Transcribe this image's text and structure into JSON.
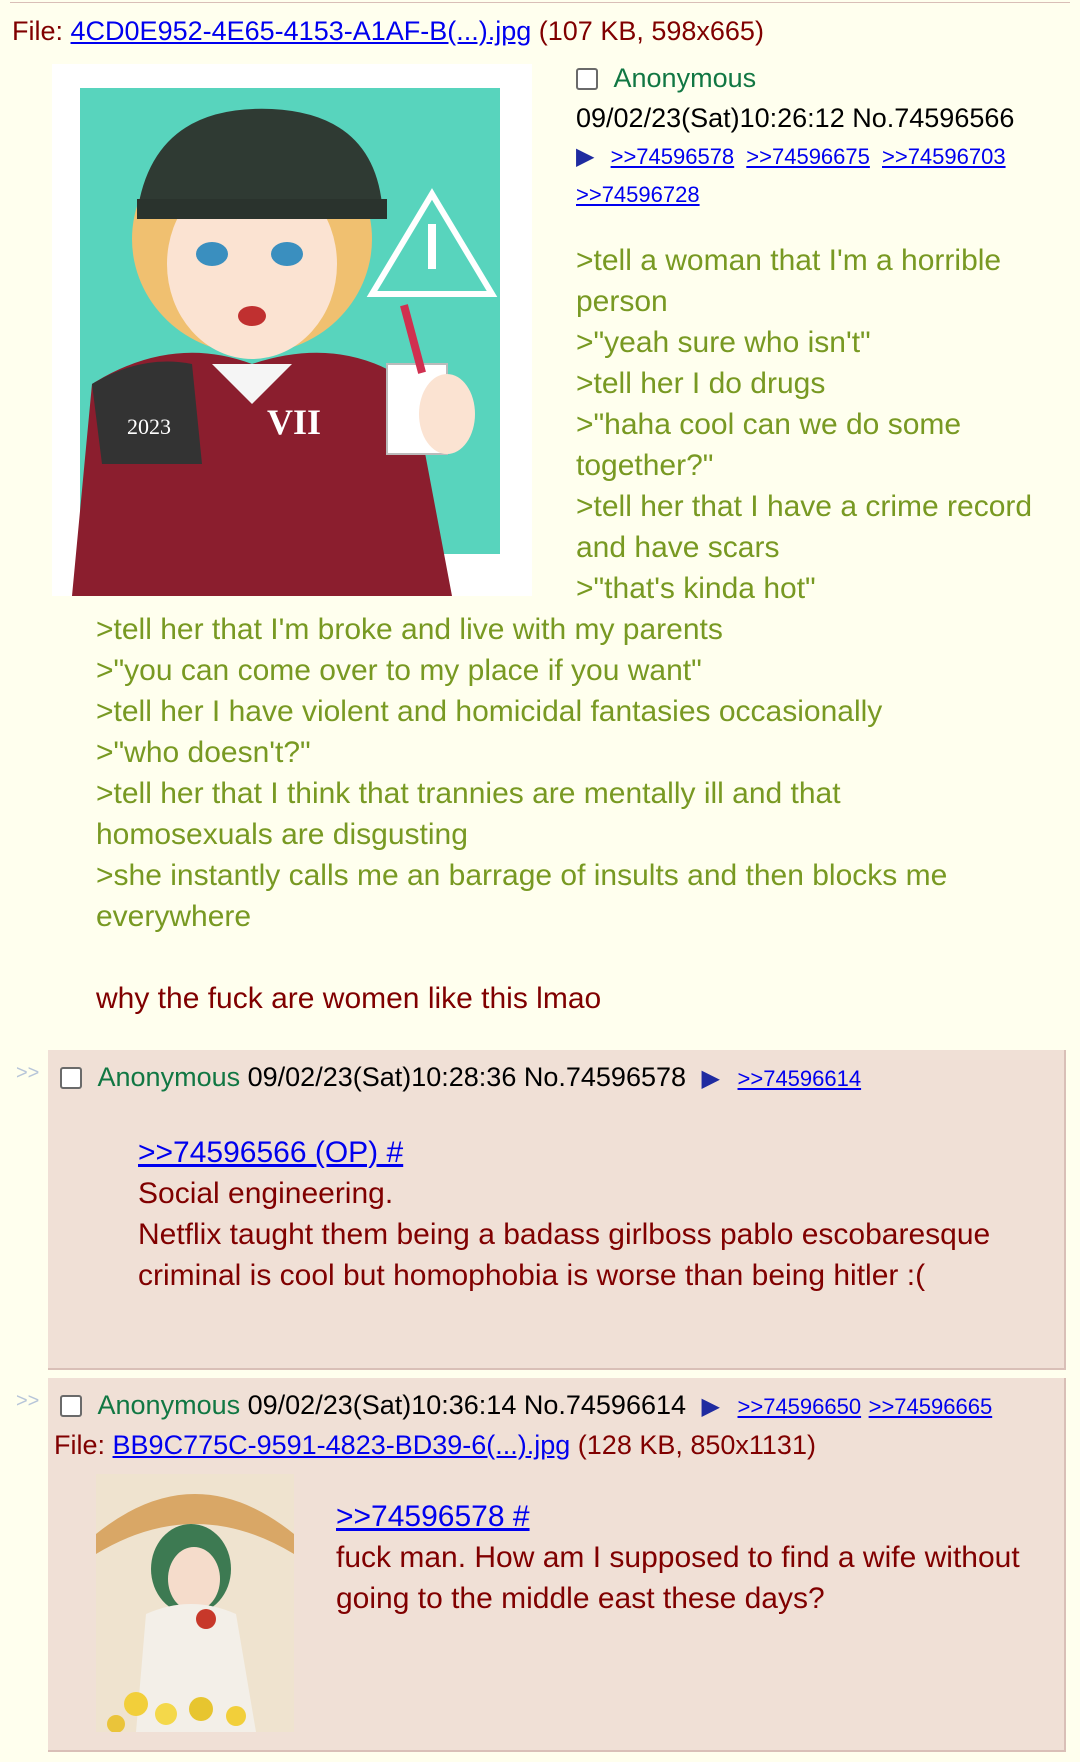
{
  "op": {
    "file_label": "File:",
    "file_name": "4CD0E952-4E65-4153-A1AF-B(...).jpg",
    "file_meta": "(107 KB, 598x665)",
    "name": "Anonymous",
    "datetime": "09/02/23(Sat)10:26:12",
    "post_no": "No.74596566",
    "backlinks": [
      ">>74596578",
      ">>74596675",
      ">>74596703",
      ">>74596728"
    ],
    "lines_right": [
      ">tell a woman that I'm a horrible person",
      ">\"yeah sure who isn't\"",
      ">tell her I do drugs",
      ">\"haha cool can we do some together?\"",
      ">tell her that I have a crime record and have scars",
      ">\"that's kinda hot\""
    ],
    "lines_full": [
      ">tell her that I'm broke and live with my parents",
      ">\"you can come over to my place if you want\"",
      ">tell her I have violent and homicidal fantasies occasionally",
      ">\"who doesn't?\"",
      ">tell her that I think that trannies are mentally ill and that homosexuals are disgusting",
      ">she instantly calls me an barrage of insults and then blocks me everywhere"
    ],
    "closing": "why the fuck are women like this lmao"
  },
  "replies": [
    {
      "side": ">>",
      "name": "Anonymous",
      "datetime": "09/02/23(Sat)10:28:36",
      "post_no": "No.74596578",
      "backlinks": [
        ">>74596614"
      ],
      "quotelink": ">>74596566 (OP) #",
      "lines": [
        "Social engineering.",
        "Netflix taught them being a badass girlboss pablo escobaresque criminal is cool but homophobia is worse than being hitler :("
      ]
    },
    {
      "side": ">>",
      "name": "Anonymous",
      "datetime": "09/02/23(Sat)10:36:14",
      "post_no": "No.74596614",
      "backlinks": [
        ">>74596650",
        ">>74596665"
      ],
      "file_label": "File:",
      "file_name": "BB9C775C-9591-4823-BD39-6(...).jpg",
      "file_meta": "(128 KB, 850x1131)",
      "quotelink": ">>74596578 #",
      "lines": [
        "fuck man. How am I supposed to find a wife without going to the middle east these days?"
      ]
    }
  ],
  "colors": {
    "page_bg": "#FFFFEE",
    "reply_bg": "#F0E0D6",
    "text": "#800000",
    "greentext": "#789922",
    "name": "#117743",
    "link": "#0000EE"
  },
  "icons": {
    "checkbox": "checkbox-icon",
    "backlink_arrow": "play-arrow-icon"
  }
}
